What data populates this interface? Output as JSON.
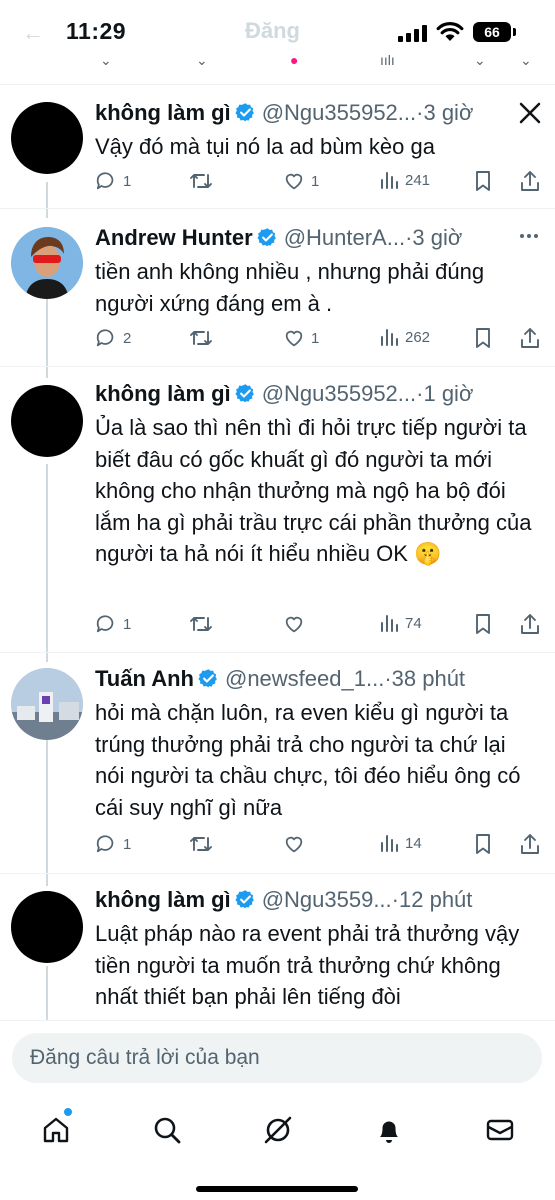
{
  "status_bar": {
    "time": "11:29",
    "battery": "66",
    "ghost_header": "Đăng"
  },
  "colors": {
    "verified": "#1d9bf0",
    "text_primary": "#0f1419",
    "text_secondary": "#536471",
    "thread_line": "#cfd9de"
  },
  "tweets": [
    {
      "name": "không làm gì",
      "handle": "@Ngu355952...",
      "time": "·3 giờ",
      "text": "Vậy đó mà tụi nó la ad bùm kèo ga",
      "replies": "1",
      "retweets": "",
      "likes": "1",
      "views": "241",
      "corner_icon": "x-close-icon"
    },
    {
      "name": "Andrew Hunter",
      "handle": "@HunterA...",
      "time": "·3 giờ",
      "text": "tiền anh không nhiều , nhưng phải đúng người xứng đáng em à .",
      "replies": "2",
      "retweets": "",
      "likes": "1",
      "views": "262",
      "corner_icon": "more-options-icon"
    },
    {
      "name": "không làm gì",
      "handle": "@Ngu355952...",
      "time": "·1 giờ",
      "text": "Ủa là sao thì nên thì đi hỏi trực tiếp người ta biết đâu có gốc khuất gì đó người ta mới không cho nhận thưởng mà ngộ ha bộ đói lắm ha gì phải trầu trực cái phần thưởng của người ta hả nói ít hiểu nhiều OK 🤫",
      "replies": "1",
      "retweets": "",
      "likes": "",
      "views": "74",
      "corner_icon": ""
    },
    {
      "name": "Tuấn Anh",
      "handle": "@newsfeed_1...",
      "time": "·38 phút",
      "text": "hỏi mà chặn luôn, ra even kiểu gì người ta trúng thưởng phải trả cho người ta chứ lại nói người ta chầu chực, tôi đéo hiểu ông có cái suy nghĩ gì nữa",
      "replies": "1",
      "retweets": "",
      "likes": "",
      "views": "14",
      "corner_icon": ""
    },
    {
      "name": "không làm gì",
      "handle": "@Ngu3559...",
      "time": "·12 phút",
      "text": "Luật pháp nào ra event phải trả thưởng vậy tiền người ta muốn trả thưởng chứ không nhất thiết bạn phải lên tiếng đòi",
      "replies": "",
      "retweets": "",
      "likes": "",
      "views": "",
      "corner_icon": ""
    }
  ],
  "reply_bar": {
    "placeholder": "Đăng câu trả lời của bạn"
  },
  "tabs": [
    {
      "icon": "home-icon"
    },
    {
      "icon": "search-icon"
    },
    {
      "icon": "grok-icon"
    },
    {
      "icon": "notifications-icon"
    },
    {
      "icon": "messages-icon"
    }
  ]
}
